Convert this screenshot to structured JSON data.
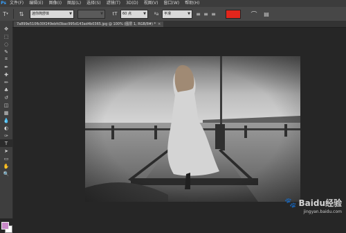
{
  "app": {
    "logo": "Ps"
  },
  "menubar": {
    "items": [
      "文件(F)",
      "编辑(E)",
      "图像(I)",
      "图层(L)",
      "选择(S)",
      "滤镜(T)",
      "3D(D)",
      "视图(V)",
      "窗口(W)",
      "帮助(H)"
    ]
  },
  "options": {
    "font_family": "迷你简舒体",
    "font_style": "",
    "font_size": "60 点",
    "antialias": "平滑",
    "text_color": "#e2261c"
  },
  "document_tab": {
    "title": "7a899e510fb30f249ebfd3bac995d143ad4b0365.jpg @ 100% (图层 1, RGB/8#) *",
    "close": "×"
  },
  "tools": [
    "move-icon",
    "marquee-icon",
    "lasso-icon",
    "quick-select-icon",
    "crop-icon",
    "eyedropper-icon",
    "healing-icon",
    "brush-icon",
    "stamp-icon",
    "history-brush-icon",
    "eraser-icon",
    "gradient-icon",
    "blur-icon",
    "dodge-icon",
    "pen-icon",
    "type-icon",
    "path-select-icon",
    "shape-icon",
    "hand-icon",
    "zoom-icon"
  ],
  "colors": {
    "foreground": "#c889c8",
    "background": "#ffffff"
  },
  "watermark": {
    "brand": "Baidu经验",
    "url": "jingyan.baidu.com"
  }
}
